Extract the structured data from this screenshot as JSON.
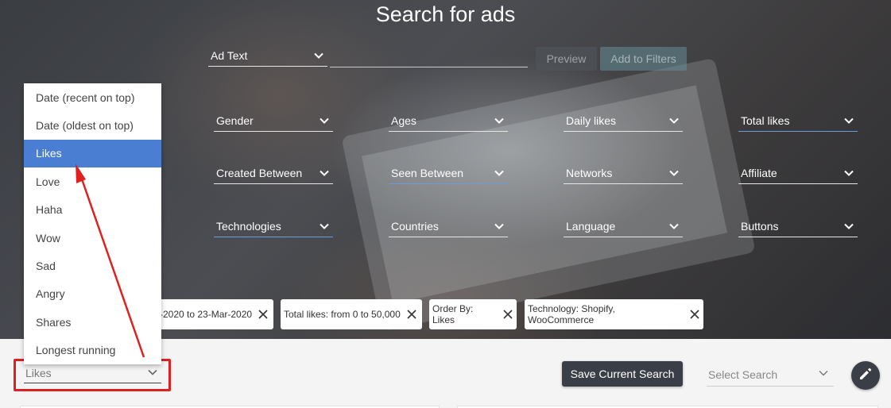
{
  "title": "Search for ads",
  "search": {
    "field_label": "Ad Text",
    "text_value": "",
    "preview_label": "Preview",
    "add_filters_label": "Add to Filters"
  },
  "filters": [
    {
      "label": "Gender"
    },
    {
      "label": "Ages"
    },
    {
      "label": "Daily likes"
    },
    {
      "label": "Total likes",
      "active": true
    },
    {
      "label": "Created Between"
    },
    {
      "label": "Seen Between",
      "active": true
    },
    {
      "label": "Networks"
    },
    {
      "label": "Affiliate"
    },
    {
      "label": "Technologies",
      "active": true
    },
    {
      "label": "Countries"
    },
    {
      "label": "Language"
    },
    {
      "label": "Buttons"
    }
  ],
  "chips": [
    {
      "label": "-2020 to 23-Mar-2020"
    },
    {
      "label": "Total likes: from 0 to 50,000"
    },
    {
      "label": "Order By: Likes"
    },
    {
      "label": "Technology: Shopify, WooCommerce"
    }
  ],
  "sort": {
    "selected": "Likes",
    "options": [
      "Date (recent on top)",
      "Date (oldest on top)",
      "Likes",
      "Love",
      "Haha",
      "Wow",
      "Sad",
      "Angry",
      "Shares",
      "Longest running"
    ]
  },
  "toolbar": {
    "save_search_label": "Save Current Search",
    "select_search_placeholder": "Select Search"
  },
  "icons": {
    "chevron": "chevron-down-icon",
    "close": "close-icon",
    "edit": "pencil-icon"
  },
  "colors": {
    "accent": "#4a7ed3",
    "highlight": "#e02020",
    "dark_button": "#3a3f47"
  }
}
